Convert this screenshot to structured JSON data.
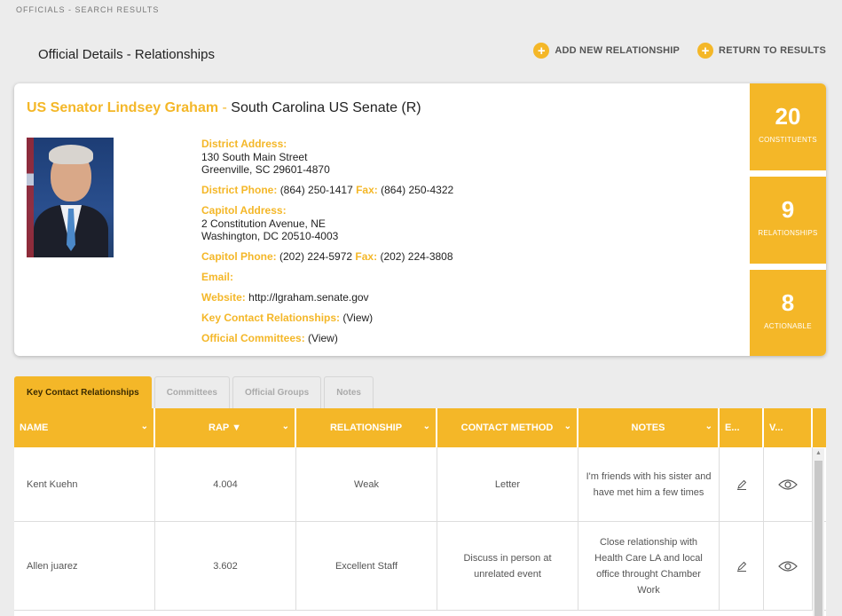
{
  "breadcrumb": "OFFICIALS - SEARCH RESULTS",
  "page_title": "Official Details - Relationships",
  "actions": {
    "add": "ADD NEW RELATIONSHIP",
    "return": "RETURN TO RESULTS",
    "icon": "plus-circle-icon"
  },
  "official": {
    "name": "US Senator Lindsey Graham",
    "separator": "-",
    "office": "South Carolina US Senate (R)",
    "district_address_label": "District Address:",
    "district_address_line1": "130 South Main Street",
    "district_address_line2": "Greenville, SC 29601-4870",
    "district_phone_label": "District Phone:",
    "district_phone": "(864) 250-1417",
    "district_fax_label": "Fax:",
    "district_fax": "(864) 250-4322",
    "capitol_address_label": "Capitol Address:",
    "capitol_address_line1": "2 Constitution Avenue, NE",
    "capitol_address_line2": "Washington, DC 20510-4003",
    "capitol_phone_label": "Capitol Phone:",
    "capitol_phone": "(202) 224-5972",
    "capitol_fax_label": "Fax:",
    "capitol_fax": "(202) 224-3808",
    "email_label": "Email:",
    "email": "",
    "website_label": "Website:",
    "website": "http://lgraham.senate.gov",
    "key_contact_label": "Key Contact Relationships:",
    "key_contact_link": "(View)",
    "committees_label": "Official Committees:",
    "committees_link": "(View)"
  },
  "stats": [
    {
      "value": "20",
      "label": "CONSTITUENTS"
    },
    {
      "value": "9",
      "label": "RELATIONSHIPS"
    },
    {
      "value": "8",
      "label": "ACTIONABLE"
    }
  ],
  "tabs": [
    "Key Contact Relationships",
    "Committees",
    "Official Groups",
    "Notes"
  ],
  "table": {
    "headers": [
      "NAME",
      "RAP ▼",
      "RELATIONSHIP",
      "CONTACT METHOD",
      "NOTES",
      "E...",
      "V..."
    ],
    "rows": [
      {
        "name": "Kent Kuehn",
        "rap": "4.004",
        "relationship": "Weak",
        "contact_method": "Letter",
        "notes": "I'm friends with his sister and have met him a few times"
      },
      {
        "name": "Allen juarez",
        "rap": "3.602",
        "relationship": "Excellent Staff",
        "contact_method": "Discuss in person at unrelated event",
        "notes": "Close relationship with Health Care LA and local office throught Chamber Work"
      }
    ]
  },
  "colors": {
    "accent": "#f4b728",
    "background": "#ececec"
  }
}
